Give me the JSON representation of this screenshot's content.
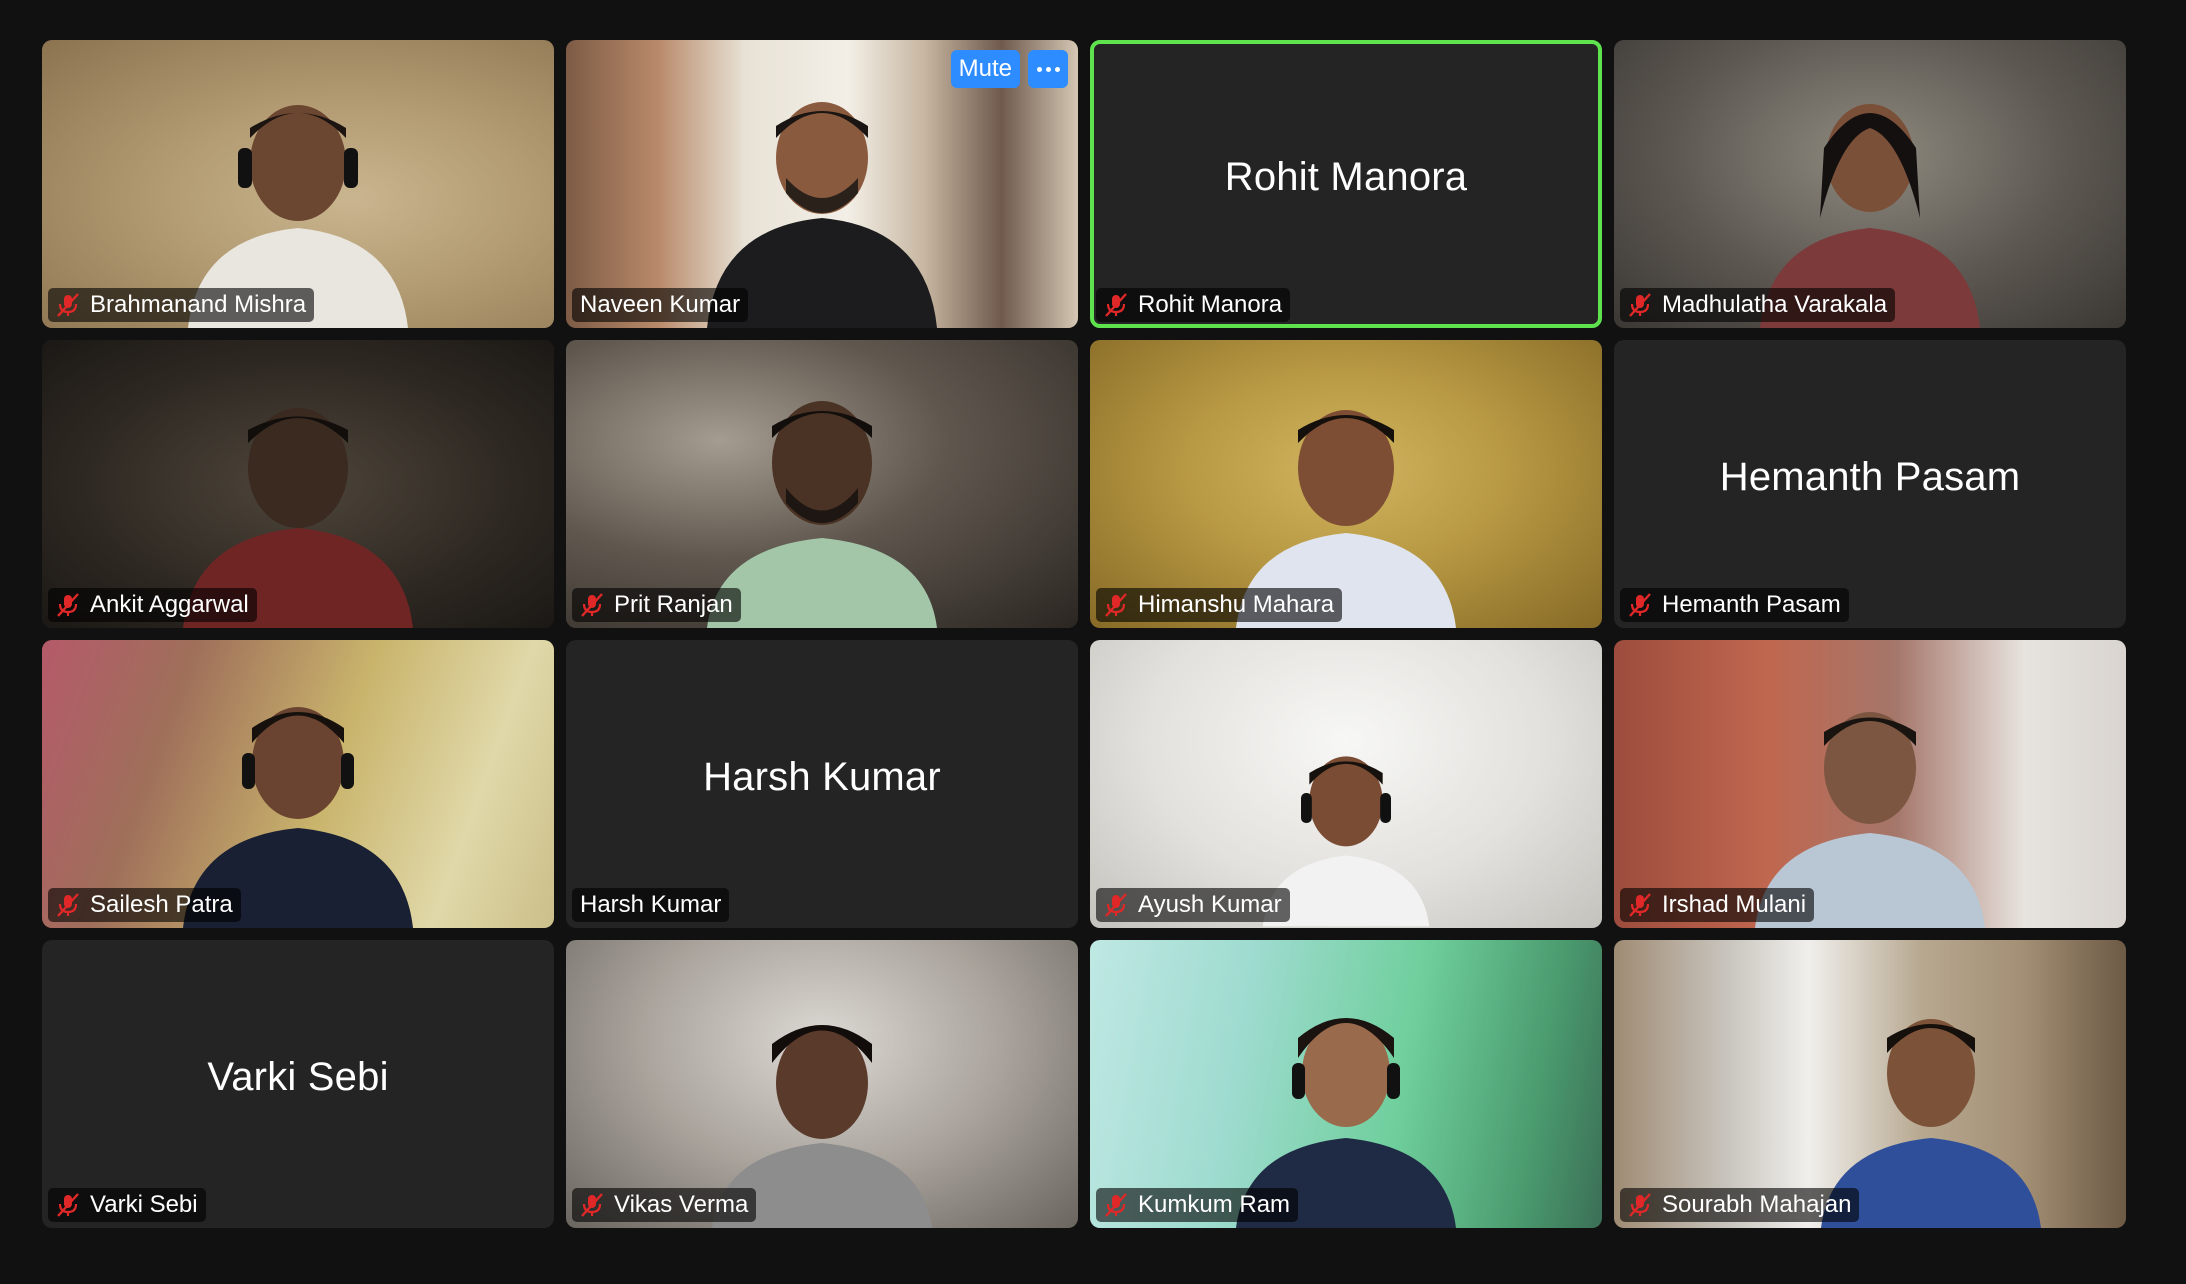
{
  "controls": {
    "mute_label": "Mute",
    "more_icon": "ellipsis-icon"
  },
  "participants": [
    {
      "name": "Brahmanand Mishra",
      "video": true,
      "muted": true
    },
    {
      "name": "Naveen Kumar",
      "video": true,
      "muted": false
    },
    {
      "name": "Rohit Manora",
      "video": false,
      "muted": true,
      "active_speaker": true
    },
    {
      "name": "Madhulatha Varakala",
      "video": true,
      "muted": true
    },
    {
      "name": "Ankit Aggarwal",
      "video": true,
      "muted": true
    },
    {
      "name": "Prit Ranjan",
      "video": true,
      "muted": true
    },
    {
      "name": "Himanshu Mahara",
      "video": true,
      "muted": true
    },
    {
      "name": "Hemanth Pasam",
      "video": false,
      "muted": true
    },
    {
      "name": "Sailesh Patra",
      "video": true,
      "muted": true
    },
    {
      "name": "Harsh Kumar",
      "video": false,
      "muted": false
    },
    {
      "name": "Ayush Kumar",
      "video": true,
      "muted": true
    },
    {
      "name": "Irshad Mulani",
      "video": true,
      "muted": true
    },
    {
      "name": "Varki Sebi",
      "video": false,
      "muted": true
    },
    {
      "name": "Vikas Verma",
      "video": true,
      "muted": true
    },
    {
      "name": "Kumkum Ram",
      "video": true,
      "muted": true
    },
    {
      "name": "Sourabh Mahajan",
      "video": true,
      "muted": true
    }
  ],
  "colors": {
    "background": "#111111",
    "tile": "#242424",
    "active_border": "#5ee34f",
    "accent": "#2d8cff",
    "muted_icon": "#e02828"
  }
}
